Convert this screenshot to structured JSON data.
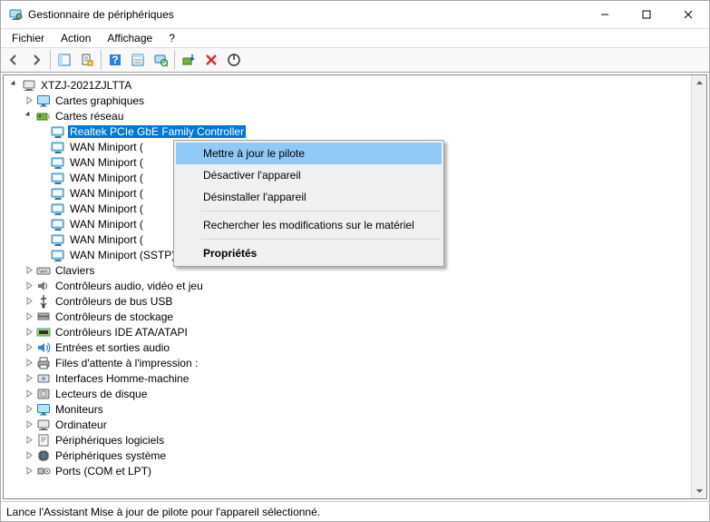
{
  "window": {
    "title": "Gestionnaire de périphériques"
  },
  "menubar": [
    "Fichier",
    "Action",
    "Affichage",
    "?"
  ],
  "toolbar_icons": [
    "back",
    "forward",
    "show-hide",
    "properties",
    "help",
    "options",
    "scan",
    "tree-view",
    "update",
    "uninstall",
    "enable-disable"
  ],
  "tree": {
    "root": {
      "label": "XTZJ-2021ZJLTTA"
    },
    "graphics": {
      "label": "Cartes graphiques"
    },
    "network": {
      "label": "Cartes réseau",
      "children": [
        "Realtek PCIe GbE Family Controller",
        "WAN Miniport (",
        "WAN Miniport (",
        "WAN Miniport (",
        "WAN Miniport (",
        "WAN Miniport (",
        "WAN Miniport (",
        "WAN Miniport (",
        "WAN Miniport (SSTP)"
      ]
    },
    "others": [
      "Claviers",
      "Contrôleurs audio, vidéo et jeu",
      "Contrôleurs de bus USB",
      "Contrôleurs de stockage",
      "Contrôleurs IDE ATA/ATAPI",
      "Entrées et sorties audio",
      "Files d'attente à l'impression :",
      "Interfaces Homme-machine",
      "Lecteurs de disque",
      "Moniteurs",
      "Ordinateur",
      "Périphériques logiciels",
      "Périphériques système",
      "Ports (COM et LPT)"
    ]
  },
  "context_menu": {
    "items": [
      "Mettre à jour le pilote",
      "Désactiver l'appareil",
      "Désinstaller l'appareil",
      "Rechercher les modifications sur le matériel",
      "Propriétés"
    ]
  },
  "statusbar": "Lance l'Assistant Mise à jour de pilote pour l'appareil sélectionné."
}
